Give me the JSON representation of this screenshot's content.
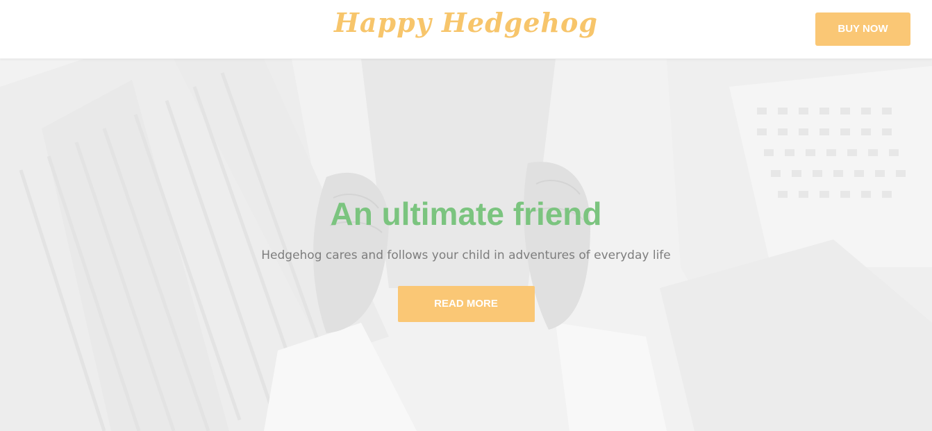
{
  "header": {
    "logo_text": "Happy Hedgehog",
    "buy_label": "BUY NOW"
  },
  "hero": {
    "title": "An ultimate friend",
    "subtitle": "Hedgehog cares and follows your child in adventures of everyday life",
    "cta_label": "READ MORE",
    "background_image": "faded photo of sneakers dangling above city buildings"
  },
  "colors": {
    "accent": "#fac775",
    "title_green": "#7bc47f",
    "subtitle_gray": "#7d7d7d",
    "header_bg": "#ffffff"
  }
}
